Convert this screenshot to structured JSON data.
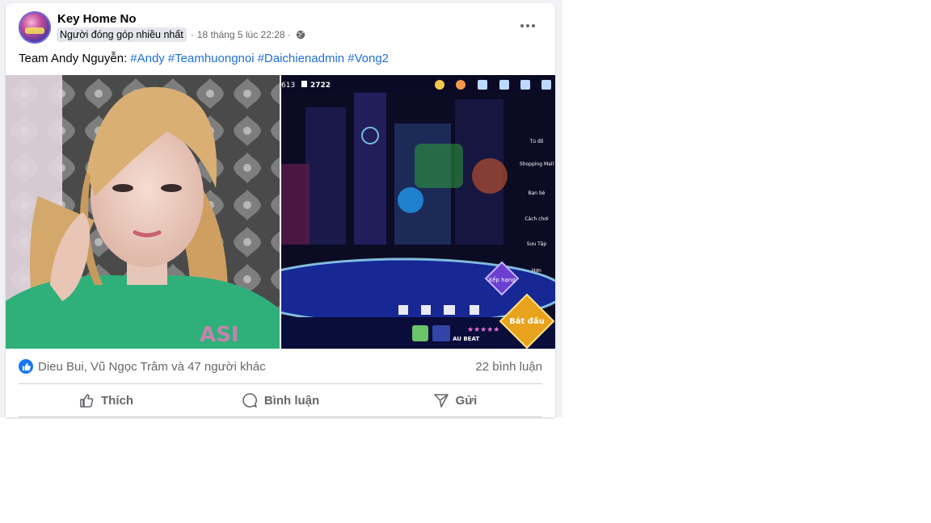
{
  "post": {
    "author": "Key Home No",
    "badge": "Người đóng góp nhiều nhất",
    "timestamp": "18 tháng 5 lúc 22:28",
    "separator": "·",
    "text_prefix": "Team Andy Nguyễn:",
    "hashtags": [
      "#Andy",
      "#Teamhuongnoi",
      "#Daichienadmin",
      "#Vong2"
    ]
  },
  "game_screenshot": {
    "stat_left": "613",
    "stat_lock": "2722",
    "menu": [
      "Tủ đồ",
      "Shopping Mall",
      "Bạn bè",
      "Cách chơi",
      "Sưu Tập",
      "Hơn"
    ],
    "rank_button": "Xếp hạng",
    "start_button": "Bắt đầu",
    "mode_label": "AU BEAT"
  },
  "footer": {
    "reactions_text": "Dieu Bui, Vũ Ngọc Trâm và 47 người khác",
    "comments_text": "22 bình luận",
    "like_label": "Thích",
    "comment_label": "Bình luận",
    "share_label": "Gửi"
  },
  "colors": {
    "brand_blue": "#1877f2",
    "hashtag": "#216fdb",
    "meta_gray": "#65676b"
  }
}
